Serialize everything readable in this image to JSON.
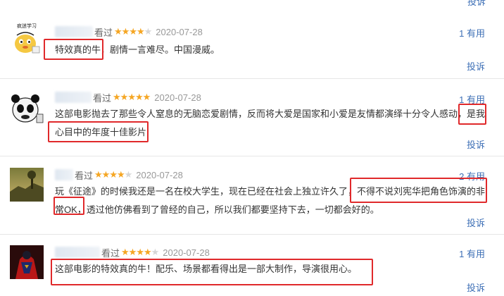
{
  "top_report_label": "投诉",
  "reviews": [
    {
      "watched": "看过",
      "stars": 4,
      "date": "2020-07-28",
      "useful": "1 有用",
      "report": "投诉",
      "avatar": "cartoon-chick-avatar",
      "avatar_caption": "疯迷学习",
      "line1": "特效真的牛，剧情一言难尽。中国漫威。",
      "line2": ""
    },
    {
      "watched": "看过",
      "stars": 5,
      "date": "2020-07-28",
      "useful": "1 有用",
      "report": "投诉",
      "avatar": "panda-meme-avatar",
      "line1": "这部电影抛去了那些令人窒息的无脑恋爱剧情，反而将大爱是国家和小爱是友情都演绎十分令人感动，是我",
      "line2": "心目中的年度十佳影片"
    },
    {
      "watched": "看过",
      "stars": 4,
      "date": "2020-07-28",
      "useful": "2 有用",
      "report": "投诉",
      "avatar": "landscape-photo-avatar",
      "line1": "玩《征途》的时候我还是一名在校大学生，现在已经在社会上独立许久了，不得不说刘宪华把角色饰演的非",
      "line2": "常OK，透过他仿佛看到了曾经的自己，所以我们都要坚持下去，一切都会好的。"
    },
    {
      "watched": "看过",
      "stars": 4,
      "date": "2020-07-28",
      "useful": "1 有用",
      "report": "投诉",
      "avatar": "superhero-avatar",
      "line1": "这部电影的特效真的牛！配乐、场景都看得出是一部大制作，导演很用心。",
      "line2": ""
    }
  ]
}
